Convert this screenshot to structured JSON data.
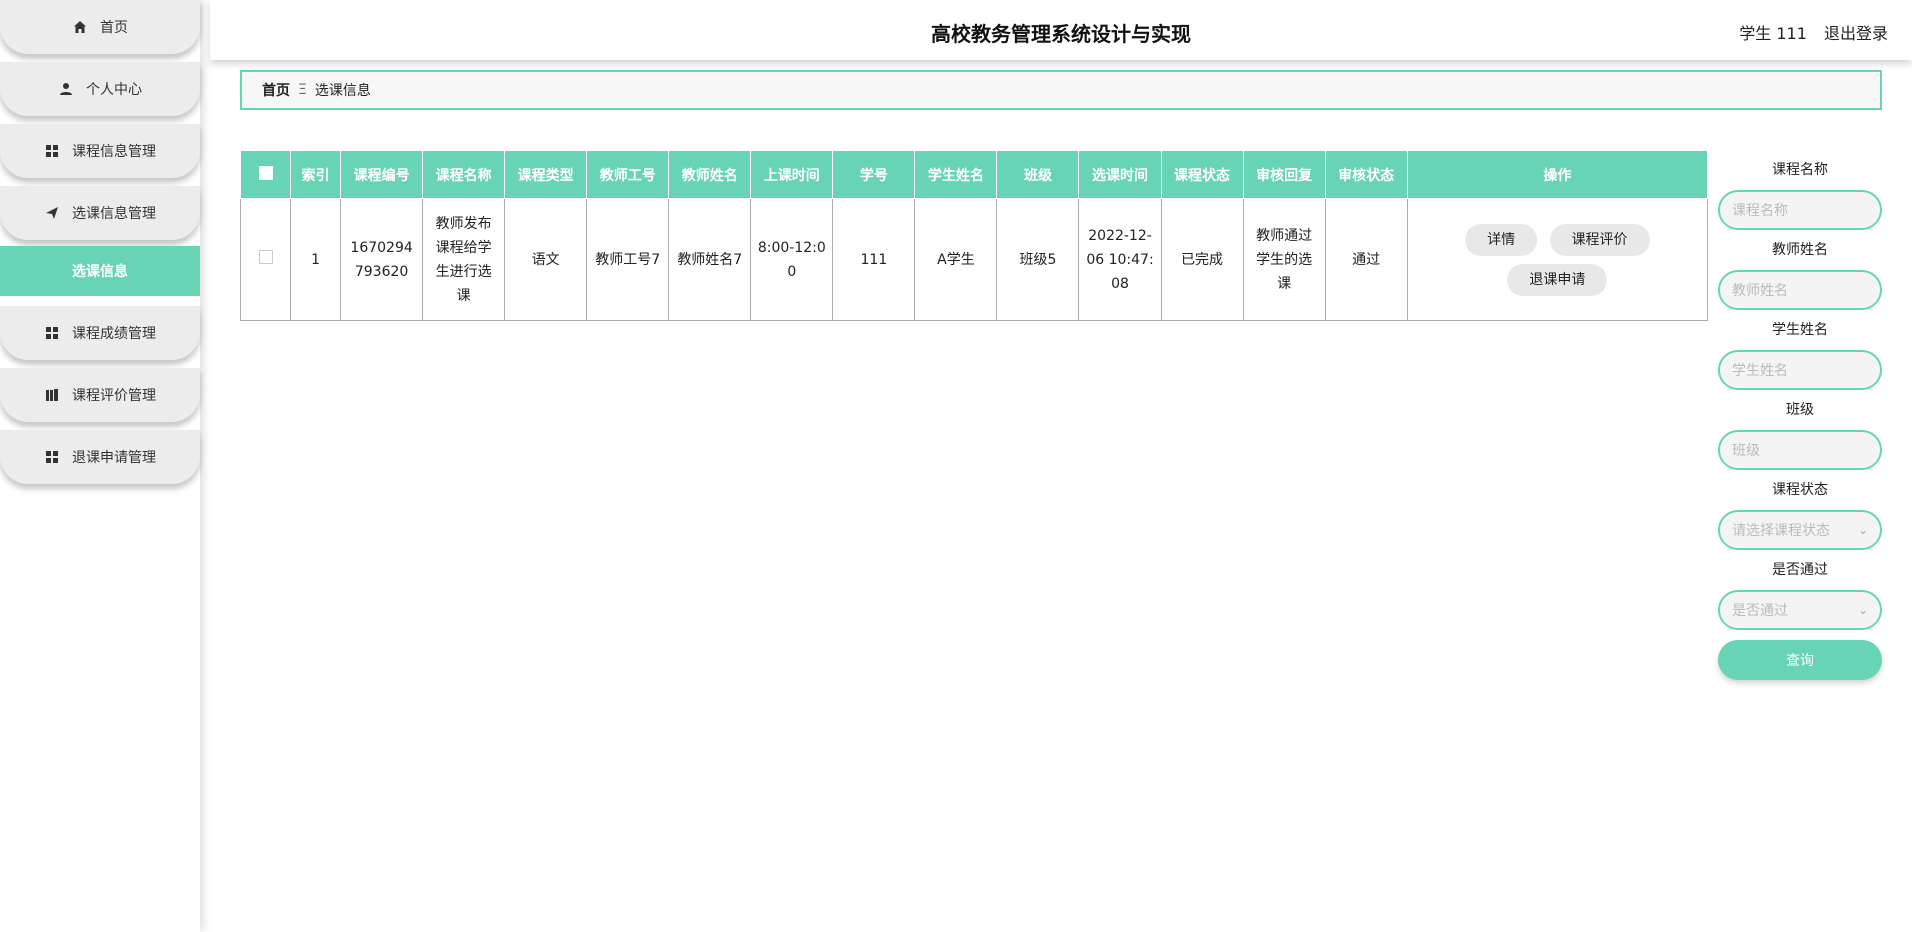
{
  "app": {
    "title": "高校教务管理系统设计与实现"
  },
  "header": {
    "user_label": "学生 111",
    "logout_label": "退出登录"
  },
  "sidebar": {
    "items": [
      {
        "label": "首页",
        "icon": "home-icon"
      },
      {
        "label": "个人中心",
        "icon": "person-icon"
      },
      {
        "label": "课程信息管理",
        "icon": "grid-icon"
      },
      {
        "label": "选课信息管理",
        "icon": "send-icon"
      },
      {
        "label": "选课信息",
        "icon": ""
      },
      {
        "label": "课程成绩管理",
        "icon": "grid-icon"
      },
      {
        "label": "课程评价管理",
        "icon": "book-icon"
      },
      {
        "label": "退课申请管理",
        "icon": "grid-icon"
      }
    ],
    "active_index": 4
  },
  "breadcrumb": {
    "home": "首页",
    "separator": "Ξ",
    "current": "选课信息"
  },
  "table": {
    "headers": [
      "",
      "索引",
      "课程编号",
      "课程名称",
      "课程类型",
      "教师工号",
      "教师姓名",
      "上课时间",
      "学号",
      "学生姓名",
      "班级",
      "选课时间",
      "课程状态",
      "审核回复",
      "审核状态",
      "操作"
    ],
    "rows": [
      {
        "index": "1",
        "course_no": "1670294793620",
        "course_name": "教师发布课程给学生进行选课",
        "course_type": "语文",
        "teacher_id": "教师工号7",
        "teacher_name": "教师姓名7",
        "class_time": "8:00-12:00",
        "student_no": "111",
        "student_name": "A学生",
        "class_name": "班级5",
        "select_time": "2022-12-06 10:47:08",
        "course_status": "已完成",
        "review_reply": "教师通过学生的选课",
        "review_status": "通过",
        "actions": [
          "详情",
          "课程评价",
          "退课申请"
        ]
      }
    ]
  },
  "filters": {
    "course_name_label": "课程名称",
    "course_name_placeholder": "课程名称",
    "teacher_name_label": "教师姓名",
    "teacher_name_placeholder": "教师姓名",
    "student_name_label": "学生姓名",
    "student_name_placeholder": "学生姓名",
    "class_label": "班级",
    "class_placeholder": "班级",
    "course_status_label": "课程状态",
    "course_status_placeholder": "请选择课程状态",
    "passed_label": "是否通过",
    "passed_placeholder": "是否通过",
    "search_label": "查询"
  },
  "colors": {
    "accent": "#67d5b5",
    "nav_bg": "#ececec"
  }
}
